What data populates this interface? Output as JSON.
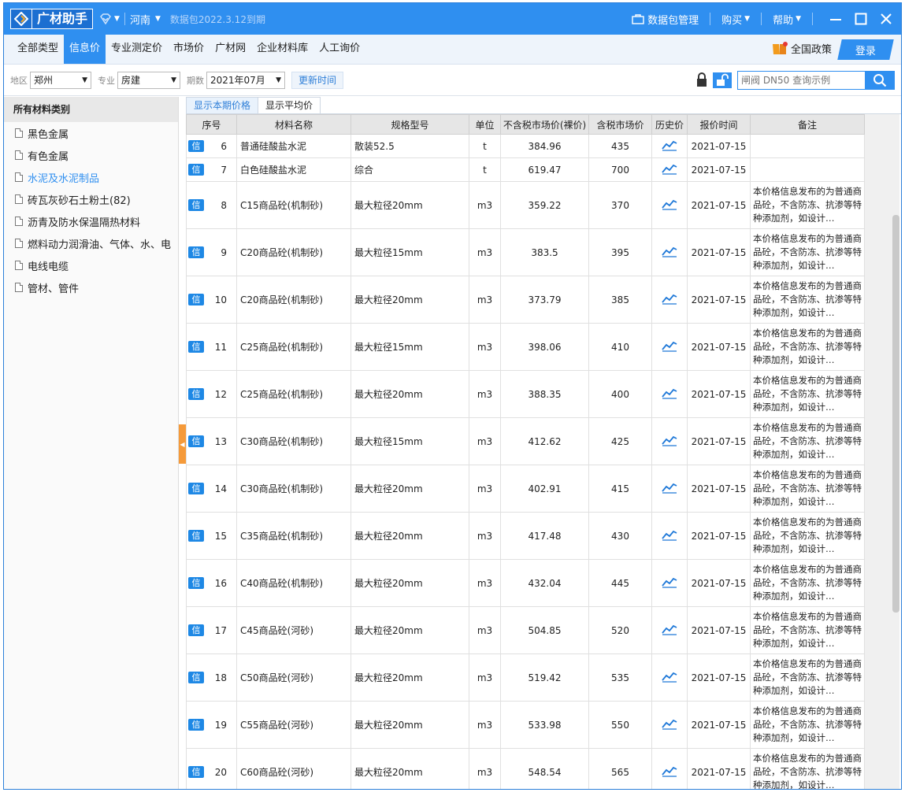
{
  "app": {
    "logo_text": "广材助手",
    "region": "河南",
    "package_expiry": "数据包2022.3.12到期",
    "pkg_manage": "数据包管理",
    "buy": "购买",
    "help": "帮助"
  },
  "nav": {
    "tabs": [
      "全部类型",
      "信息价",
      "专业测定价",
      "市场价",
      "广材网",
      "企业材料库",
      "人工询价"
    ],
    "active": "信息价",
    "policy": "全国政策",
    "login": "登录"
  },
  "filter": {
    "area_label": "地区",
    "area_value": "郑州",
    "major_label": "专业",
    "major_value": "房建",
    "period_label": "期数",
    "period_value": "2021年07月",
    "update_btn": "更新时间",
    "search_placeholder": "闸阀 DN50 查询示例"
  },
  "sidebar": {
    "header": "所有材料类别",
    "items": [
      "黑色金属",
      "有色金属",
      "水泥及水泥制品",
      "砖瓦灰砂石土粉土(82)",
      "沥青及防水保温隔热材料",
      "燃料动力润滑油、气体、水、电",
      "电线电缆",
      "管材、管件"
    ],
    "active_index": 2
  },
  "subtabs": [
    "显示本期价格",
    "显示平均价"
  ],
  "table": {
    "columns": [
      "序号",
      "材料名称",
      "规格型号",
      "单位",
      "不含税市场价(裸价)",
      "含税市场价",
      "历史价",
      "报价时间",
      "备注"
    ],
    "badge": "信",
    "note": "本价格信息发布的为普通商品砼，不含防冻、抗渗等特种添加剂，如设计…",
    "rows": [
      {
        "seq": "6",
        "name": "普通硅酸盐水泥",
        "spec": "散装52.5",
        "unit": "t",
        "price_ex": "384.96",
        "price_in": "435",
        "date": "2021-07-15",
        "has_note": false
      },
      {
        "seq": "7",
        "name": "白色硅酸盐水泥",
        "spec": "综合",
        "unit": "t",
        "price_ex": "619.47",
        "price_in": "700",
        "date": "2021-07-15",
        "has_note": false
      },
      {
        "seq": "8",
        "name": "C15商品砼(机制砂)",
        "spec": "最大粒径20mm",
        "unit": "m3",
        "price_ex": "359.22",
        "price_in": "370",
        "date": "2021-07-15",
        "has_note": true
      },
      {
        "seq": "9",
        "name": "C20商品砼(机制砂)",
        "spec": "最大粒径15mm",
        "unit": "m3",
        "price_ex": "383.5",
        "price_in": "395",
        "date": "2021-07-15",
        "has_note": true
      },
      {
        "seq": "10",
        "name": "C20商品砼(机制砂)",
        "spec": "最大粒径20mm",
        "unit": "m3",
        "price_ex": "373.79",
        "price_in": "385",
        "date": "2021-07-15",
        "has_note": true
      },
      {
        "seq": "11",
        "name": "C25商品砼(机制砂)",
        "spec": "最大粒径15mm",
        "unit": "m3",
        "price_ex": "398.06",
        "price_in": "410",
        "date": "2021-07-15",
        "has_note": true
      },
      {
        "seq": "12",
        "name": "C25商品砼(机制砂)",
        "spec": "最大粒径20mm",
        "unit": "m3",
        "price_ex": "388.35",
        "price_in": "400",
        "date": "2021-07-15",
        "has_note": true
      },
      {
        "seq": "13",
        "name": "C30商品砼(机制砂)",
        "spec": "最大粒径15mm",
        "unit": "m3",
        "price_ex": "412.62",
        "price_in": "425",
        "date": "2021-07-15",
        "has_note": true
      },
      {
        "seq": "14",
        "name": "C30商品砼(机制砂)",
        "spec": "最大粒径20mm",
        "unit": "m3",
        "price_ex": "402.91",
        "price_in": "415",
        "date": "2021-07-15",
        "has_note": true
      },
      {
        "seq": "15",
        "name": "C35商品砼(机制砂)",
        "spec": "最大粒径20mm",
        "unit": "m3",
        "price_ex": "417.48",
        "price_in": "430",
        "date": "2021-07-15",
        "has_note": true
      },
      {
        "seq": "16",
        "name": "C40商品砼(机制砂)",
        "spec": "最大粒径20mm",
        "unit": "m3",
        "price_ex": "432.04",
        "price_in": "445",
        "date": "2021-07-15",
        "has_note": true
      },
      {
        "seq": "17",
        "name": "C45商品砼(河砂)",
        "spec": "最大粒径20mm",
        "unit": "m3",
        "price_ex": "504.85",
        "price_in": "520",
        "date": "2021-07-15",
        "has_note": true
      },
      {
        "seq": "18",
        "name": "C50商品砼(河砂)",
        "spec": "最大粒径20mm",
        "unit": "m3",
        "price_ex": "519.42",
        "price_in": "535",
        "date": "2021-07-15",
        "has_note": true
      },
      {
        "seq": "19",
        "name": "C55商品砼(河砂)",
        "spec": "最大粒径20mm",
        "unit": "m3",
        "price_ex": "533.98",
        "price_in": "550",
        "date": "2021-07-15",
        "has_note": true
      },
      {
        "seq": "20",
        "name": "C60商品砼(河砂)",
        "spec": "最大粒径20mm",
        "unit": "m3",
        "price_ex": "548.54",
        "price_in": "565",
        "date": "2021-07-15",
        "has_note": true
      }
    ]
  },
  "colors": {
    "primary": "#2f8ff0",
    "badge": "#1e88e5",
    "grip": "#f59a3a"
  }
}
